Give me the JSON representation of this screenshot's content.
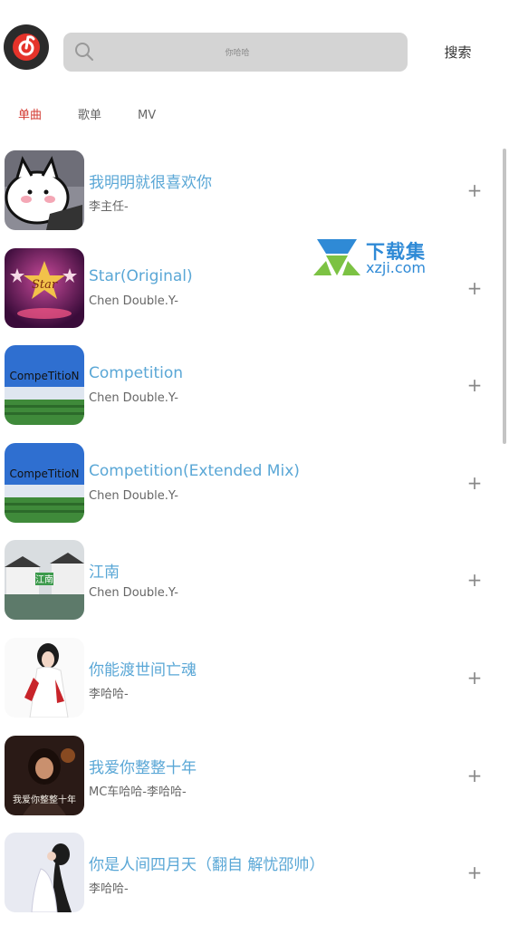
{
  "header": {
    "search_placeholder": "你哈哈",
    "search_button": "搜索"
  },
  "tabs": [
    {
      "label": "单曲",
      "active": true
    },
    {
      "label": "歌单",
      "active": false
    },
    {
      "label": "MV",
      "active": false
    }
  ],
  "songs": [
    {
      "title": "我明明就很喜欢你",
      "artist": "李主任-",
      "cover": "cartoon-pig"
    },
    {
      "title": "Star(Original)",
      "artist": "Chen Double.Y-",
      "cover": "star-stage"
    },
    {
      "title": "Competition",
      "artist": "Chen Double.Y-",
      "cover": "stadium"
    },
    {
      "title": "Competition(Extended Mix)",
      "artist": "Chen Double.Y-",
      "cover": "stadium"
    },
    {
      "title": "江南",
      "artist": "Chen Double.Y-",
      "cover": "water-town"
    },
    {
      "title": "你能渡世间亡魂",
      "artist": "李哈哈-",
      "cover": "girl-red-white"
    },
    {
      "title": "我爱你整整十年",
      "artist": "MC车哈哈-李哈哈-",
      "cover": "girl-dark"
    },
    {
      "title": "你是人间四月天（翻自 解忧邵帅）",
      "artist": "李哈哈-",
      "cover": "girl-light"
    }
  ],
  "cover_texts": {
    "star": "Star",
    "competition": "CompeTitioN",
    "jiangnan": "江南",
    "ten_years": "我爱你整整十年"
  },
  "add_symbol": "+",
  "watermark": {
    "cn": "下载集",
    "en": "xzji.com"
  },
  "colors": {
    "accent": "#d33a31",
    "title": "#5aa7d6",
    "search_bg": "#d4d4d4"
  }
}
